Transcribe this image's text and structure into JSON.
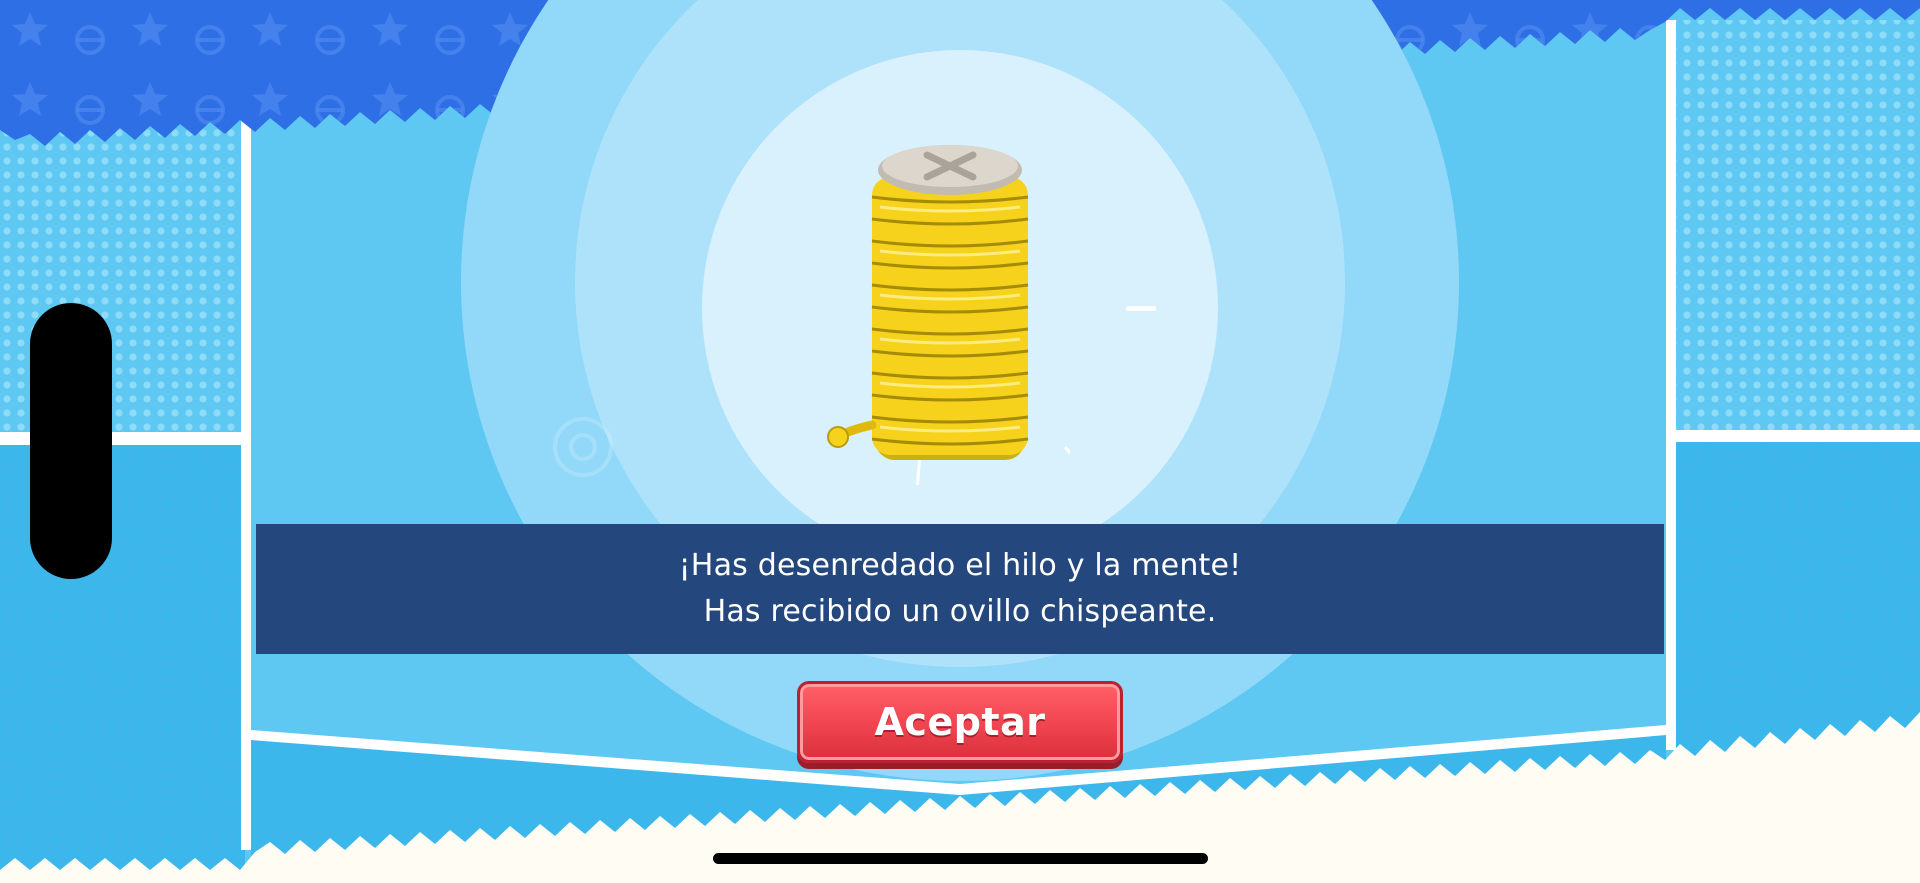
{
  "dialog": {
    "line1": "¡Has desenredado el hilo y la mente!",
    "line2": "Has recibido un ovillo chispeante."
  },
  "actions": {
    "accept_label": "Aceptar"
  },
  "reward_item": {
    "icon": "yarn-spool-icon",
    "color": "#f7d21c"
  },
  "colors": {
    "top_banner": "#2f6fe6",
    "background": "#5ec8f2",
    "message_bar": "#24487e",
    "accept_button": "#f04450",
    "floor": "#fffcf3"
  }
}
